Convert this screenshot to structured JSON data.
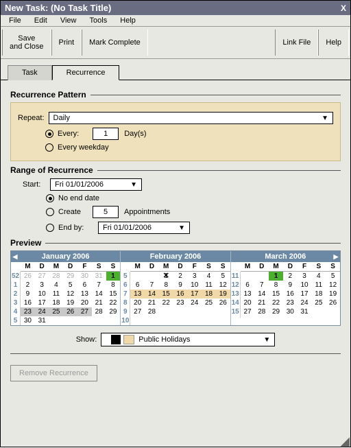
{
  "window": {
    "title": "New Task: (No Task Title)",
    "close": "X"
  },
  "menu": {
    "file": "File",
    "edit": "Edit",
    "view": "View",
    "tools": "Tools",
    "help": "Help"
  },
  "toolbar": {
    "save": "Save\nand Close",
    "print": "Print",
    "complete": "Mark Complete",
    "link": "Link File",
    "help": "Help"
  },
  "tabs": {
    "task": "Task",
    "recurrence": "Recurrence"
  },
  "pattern": {
    "title": "Recurrence Pattern",
    "repeat_lbl": "Repeat:",
    "repeat_val": "Daily",
    "every_lbl": "Every:",
    "every_val": "1",
    "days_lbl": "Day(s)",
    "weekday_lbl": "Every weekday"
  },
  "range": {
    "title": "Range of Recurrence",
    "start_lbl": "Start:",
    "start_val": "Fri 01/01/2006",
    "noend_lbl": "No end date",
    "create_lbl": "Create",
    "create_val": "5",
    "appts_lbl": "Appointments",
    "endby_lbl": "End by:",
    "endby_val": "Fri 01/01/2006"
  },
  "preview": {
    "title": "Preview",
    "show_lbl": "Show:",
    "show_val": "Public Holidays",
    "months": [
      {
        "name": "January 2006",
        "nav_prev": true
      },
      {
        "name": "February 2006"
      },
      {
        "name": "March 2006",
        "nav_next": true
      }
    ],
    "dow": [
      "M",
      "D",
      "M",
      "D",
      "F",
      "S",
      "S"
    ]
  },
  "remove_btn": "Remove Recurrence"
}
